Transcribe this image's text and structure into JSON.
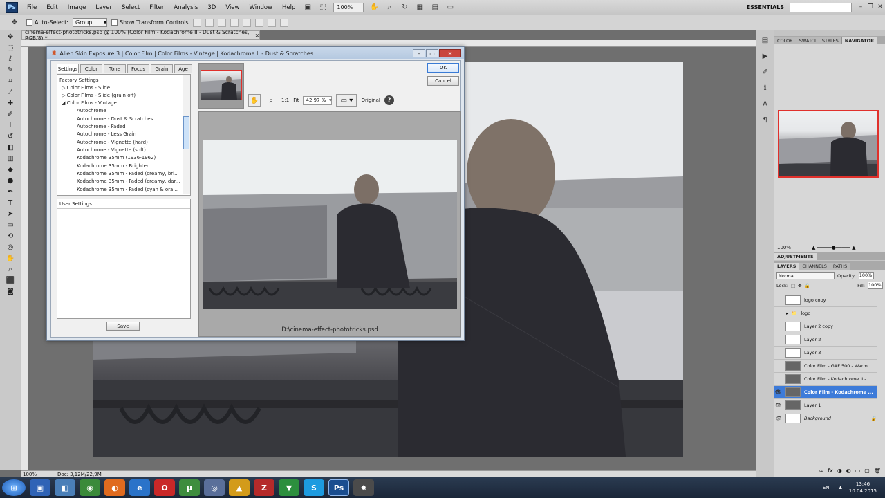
{
  "menubar": {
    "logo": "Ps",
    "items": [
      "File",
      "Edit",
      "Image",
      "Layer",
      "Select",
      "Filter",
      "Analysis",
      "3D",
      "View",
      "Window",
      "Help"
    ],
    "zoom": "100%",
    "workspace": "ESSENTIALS"
  },
  "options": {
    "auto_select_label": "Auto-Select:",
    "auto_select_value": "Group",
    "transform_label": "Show Transform Controls"
  },
  "document": {
    "tab_title": "cinema-effect-phototricks.psd @ 100% (Color Film - Kodachrome II - Dust & Scratches, RGB/8) *",
    "status_zoom": "100%",
    "status_doc": "Doc: 3,12M/22,9M"
  },
  "dialog": {
    "title": "Alien Skin Exposure 3 | Color Film | Color Films - Vintage | Kodachrome II - Dust & Scratches",
    "tabs": [
      "Settings",
      "Color",
      "Tone",
      "Focus",
      "Grain",
      "Age"
    ],
    "tree_header": "Factory Settings",
    "groups": [
      {
        "label": "Color Films - Slide",
        "state": "collapsed"
      },
      {
        "label": "Color Films - Slide (grain off)",
        "state": "collapsed"
      },
      {
        "label": "Color Films - Vintage",
        "state": "expanded"
      }
    ],
    "presets": [
      "Autochrome",
      "Autochrome - Dust & Scratches",
      "Autochrome - Faded",
      "Autochrome - Less Grain",
      "Autochrome - Vignette (hard)",
      "Autochrome - Vignette (soft)",
      "Kodachrome 35mm (1936-1962)",
      "Kodachrome 35mm - Brighter",
      "Kodachrome 35mm - Faded (creamy, bri...",
      "Kodachrome 35mm - Faded (creamy, dar...",
      "Kodachrome 35mm - Faded (cyan & ora..."
    ],
    "user_settings_label": "User Settings",
    "save_label": "Save",
    "ok_label": "OK",
    "cancel_label": "Cancel",
    "zoom_1to1": "1:1",
    "zoom_fit": "Fit",
    "zoom_value": "42.97 %",
    "original_label": "Original",
    "help_label": "?",
    "caption": "D:\\cinema-effect-phototricks.psd"
  },
  "navigator": {
    "tabs": [
      "COLOR",
      "SWATCI",
      "STYLES",
      "NAVIGATOR"
    ],
    "zoom": "100%"
  },
  "adjustments_label": "ADJUSTMENTS",
  "layers": {
    "tabs": [
      "LAYERS",
      "CHANNELS",
      "PATHS"
    ],
    "blend_mode": "Normal",
    "opacity_label": "Opacity:",
    "opacity": "100%",
    "lock_label": "Lock:",
    "fill_label": "Fill:",
    "fill": "100%",
    "rows": [
      {
        "name": "logo copy",
        "visible": false
      },
      {
        "name": "logo",
        "visible": false,
        "group": true
      },
      {
        "name": "Layer 2 copy",
        "visible": false
      },
      {
        "name": "Layer 2",
        "visible": false
      },
      {
        "name": "Layer 3",
        "visible": false
      },
      {
        "name": "Color Film - GAF 500 - Warm",
        "visible": false
      },
      {
        "name": "Color Film - Kodachrome II -...",
        "visible": false
      },
      {
        "name": "Color Film - Kodachrome ...",
        "visible": true,
        "selected": true
      },
      {
        "name": "Layer 1",
        "visible": true
      },
      {
        "name": "Background",
        "visible": true,
        "italic": true
      }
    ]
  },
  "taskbar": {
    "language": "EN",
    "time": "13:46",
    "date": "10.04.2015"
  },
  "colors": {
    "selection": "#3d7bd9",
    "nav_frame": "#e0302b",
    "taskbar": "#1a2638"
  }
}
